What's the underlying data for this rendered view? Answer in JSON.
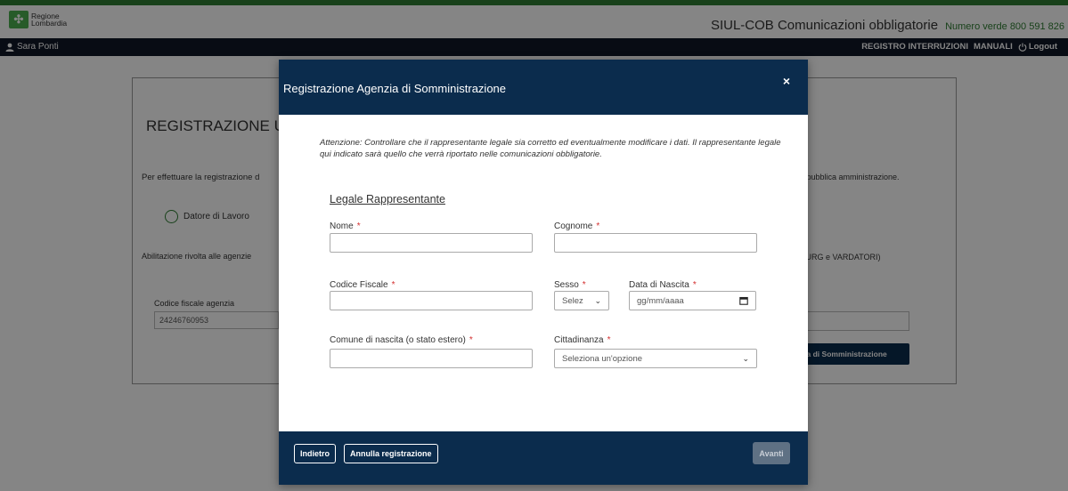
{
  "header": {
    "logo_line1": "Regione",
    "logo_line2": "Lombardia",
    "app_title": "SIUL-COB Comunicazioni obbligatorie",
    "numero_verde": "Numero verde 800 591 826"
  },
  "navbar": {
    "user_name": "Sara Ponti",
    "items": [
      "REGISTRO INTERRUZIONI",
      "MANUALI",
      "Logout"
    ]
  },
  "background": {
    "title": "REGISTRAZIONE UTENT",
    "intro_text": "Per effettuare la registrazione d",
    "radio_label": "Datore di Lavoro",
    "abilitazione_text": "Abilitazione rivolta alle agenzie",
    "cf_label": "Codice fiscale agenzia",
    "cf_value": "24246760953",
    "right_text1": "alla pubblica amministrazione.",
    "right_text2": "UNIURG e VARDATORI)",
    "right_button": "enzia di Somministrazione"
  },
  "modal": {
    "title": "Registrazione Agenzia di Somministrazione",
    "close": "×",
    "warning": "Attenzione: Controllare che il rappresentante legale sia corretto ed eventualmente modificare i dati. Il rappresentante legale qui indicato sarà quello che verrà riportato nelle comunicazioni obbligatorie.",
    "section_title": "Legale Rappresentante",
    "fields": {
      "nome": {
        "label": "Nome",
        "value": ""
      },
      "cognome": {
        "label": "Cognome",
        "value": ""
      },
      "codice_fiscale": {
        "label": "Codice Fiscale",
        "value": ""
      },
      "sesso": {
        "label": "Sesso",
        "selected": "Selez"
      },
      "data_nascita": {
        "label": "Data di Nascita",
        "placeholder": "gg/mm/aaaa"
      },
      "comune_nascita": {
        "label": "Comune di nascita (o stato estero)",
        "value": ""
      },
      "cittadinanza": {
        "label": "Cittadinanza",
        "selected": "Seleziona un'opzione"
      }
    },
    "required_mark": "*",
    "footer": {
      "back": "Indietro",
      "cancel": "Annulla registrazione",
      "next": "Avanti"
    }
  }
}
